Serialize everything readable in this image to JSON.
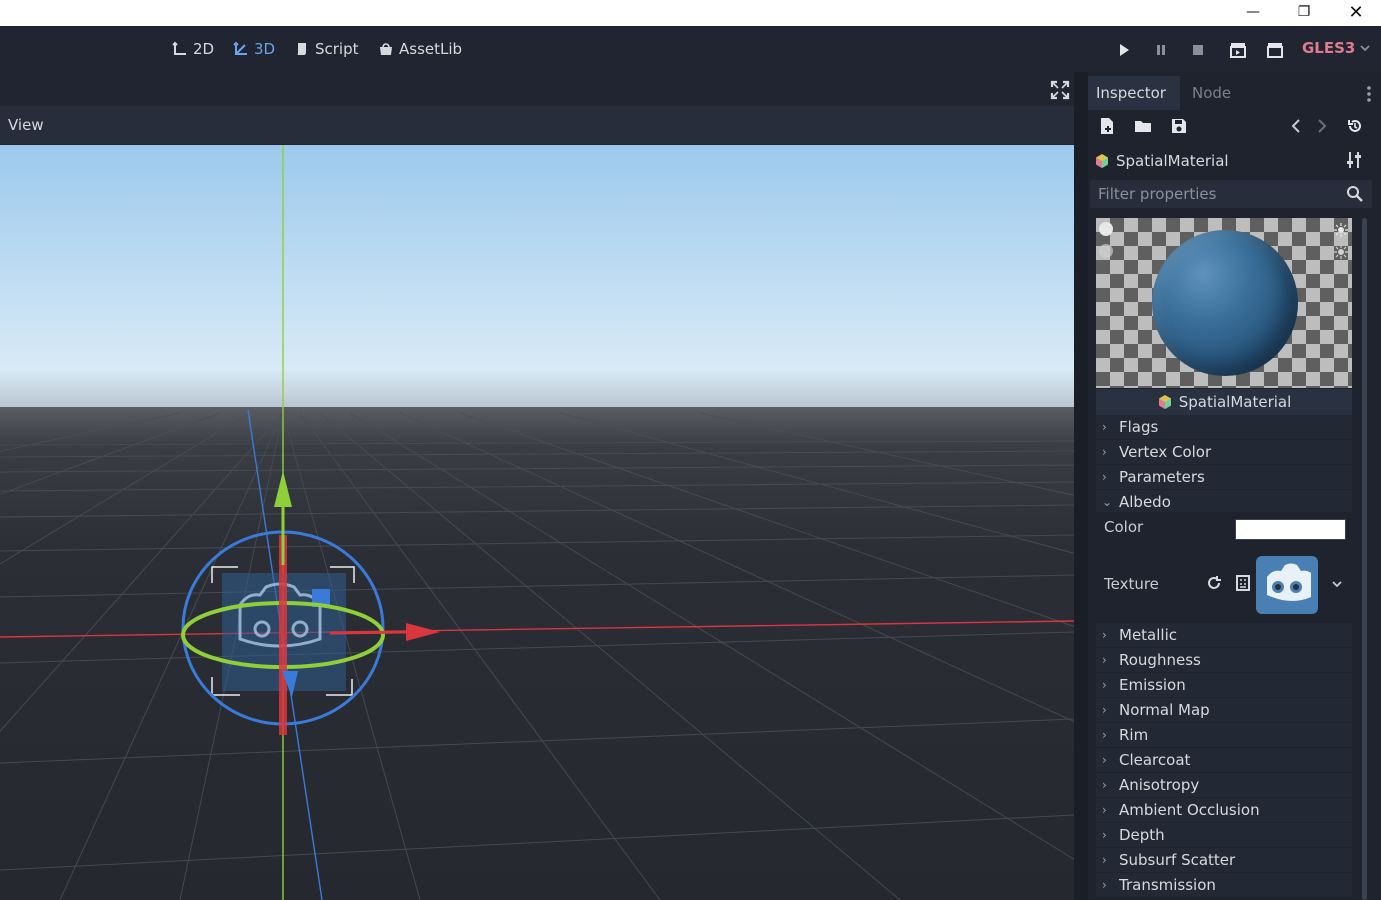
{
  "window_controls": {
    "minimize": "—",
    "maximize": "❐",
    "close": "✕"
  },
  "main_modes": [
    {
      "label": "2D"
    },
    {
      "label": "3D"
    },
    {
      "label": "Script"
    },
    {
      "label": "AssetLib"
    }
  ],
  "run_controls": {
    "renderer": "GLES3"
  },
  "viewport": {
    "view_menu": "View"
  },
  "inspector": {
    "tabs": [
      "Inspector",
      "Node"
    ],
    "resource_name": "SpatialMaterial",
    "filter_placeholder": "Filter properties",
    "preview_label": "SpatialMaterial",
    "sections_top": [
      "Flags",
      "Vertex Color",
      "Parameters",
      "Albedo"
    ],
    "albedo": {
      "color_label": "Color",
      "texture_label": "Texture",
      "color_value": "#ffffff"
    },
    "sections_bottom": [
      "Metallic",
      "Roughness",
      "Emission",
      "Normal Map",
      "Rim",
      "Clearcoat",
      "Anisotropy",
      "Ambient Occlusion",
      "Depth",
      "Subsurf Scatter",
      "Transmission"
    ]
  },
  "colors": {
    "accent": "#6ba3ec",
    "renderer": "#e07a93",
    "x_axis": "#d9363e",
    "y_axis": "#8fcf3a",
    "z_axis": "#3a7ad9"
  }
}
